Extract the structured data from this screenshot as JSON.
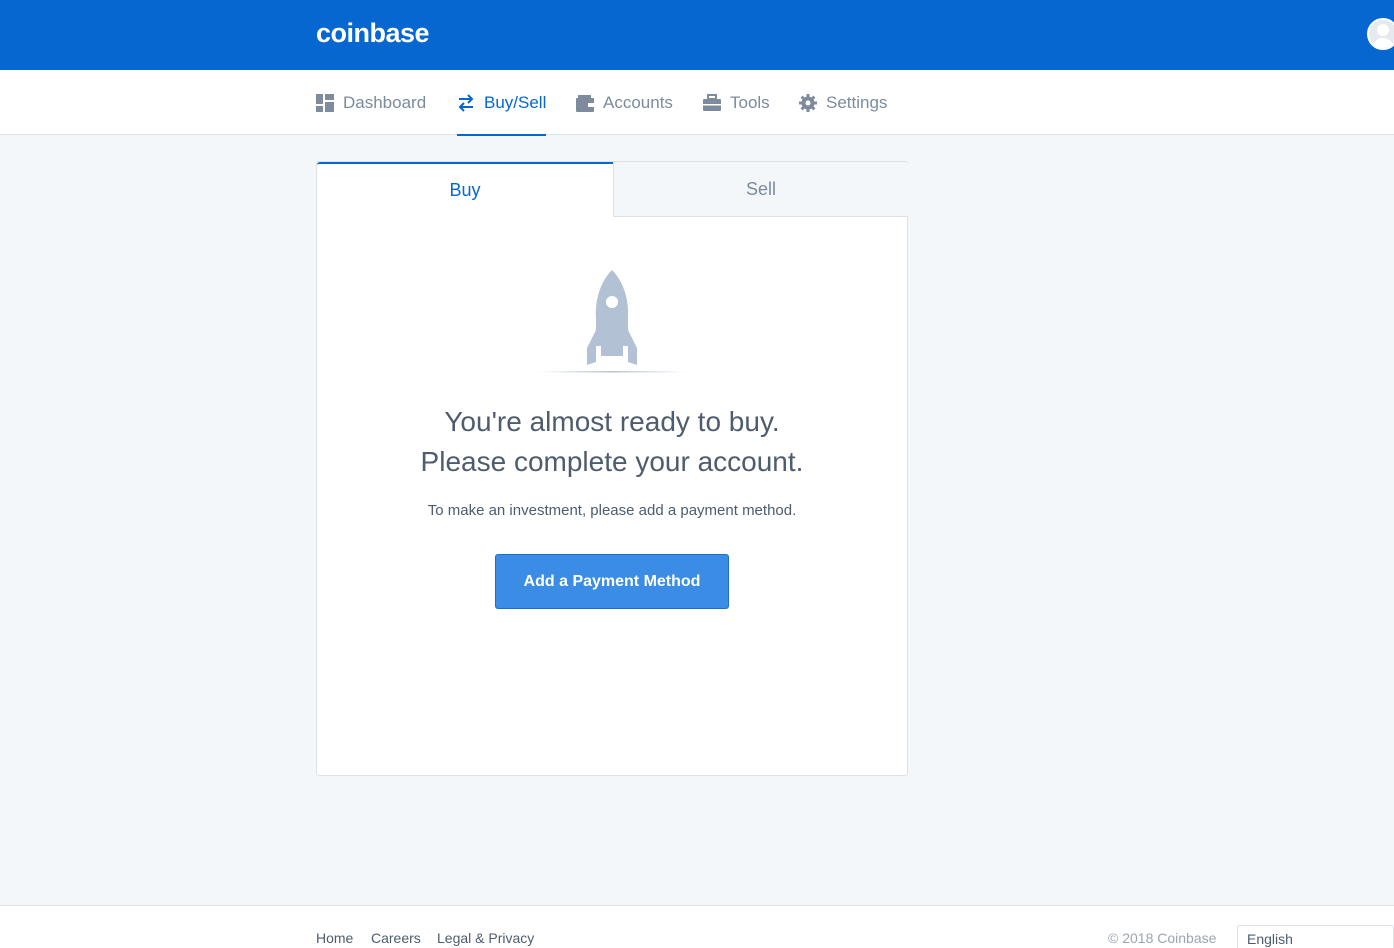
{
  "header": {
    "logo": "coinbase",
    "brand_color": "#0667d0"
  },
  "nav": {
    "items": [
      {
        "label": "Dashboard",
        "icon": "dashboard-icon",
        "active": false
      },
      {
        "label": "Buy/Sell",
        "icon": "swap-arrows-icon",
        "active": true
      },
      {
        "label": "Accounts",
        "icon": "wallet-icon",
        "active": false
      },
      {
        "label": "Tools",
        "icon": "briefcase-icon",
        "active": false
      },
      {
        "label": "Settings",
        "icon": "gear-icon",
        "active": false
      }
    ]
  },
  "trade": {
    "tabs": [
      "Buy",
      "Sell"
    ],
    "active_tab": "Buy",
    "headline_line1": "You're almost ready to buy.",
    "headline_line2": "Please complete your account.",
    "subtext": "To make an investment, please add a payment method.",
    "cta_label": "Add a Payment Method"
  },
  "footer": {
    "links": [
      "Home",
      "Careers",
      "Legal & Privacy"
    ],
    "copyright": "© 2018 Coinbase",
    "language": "English"
  }
}
